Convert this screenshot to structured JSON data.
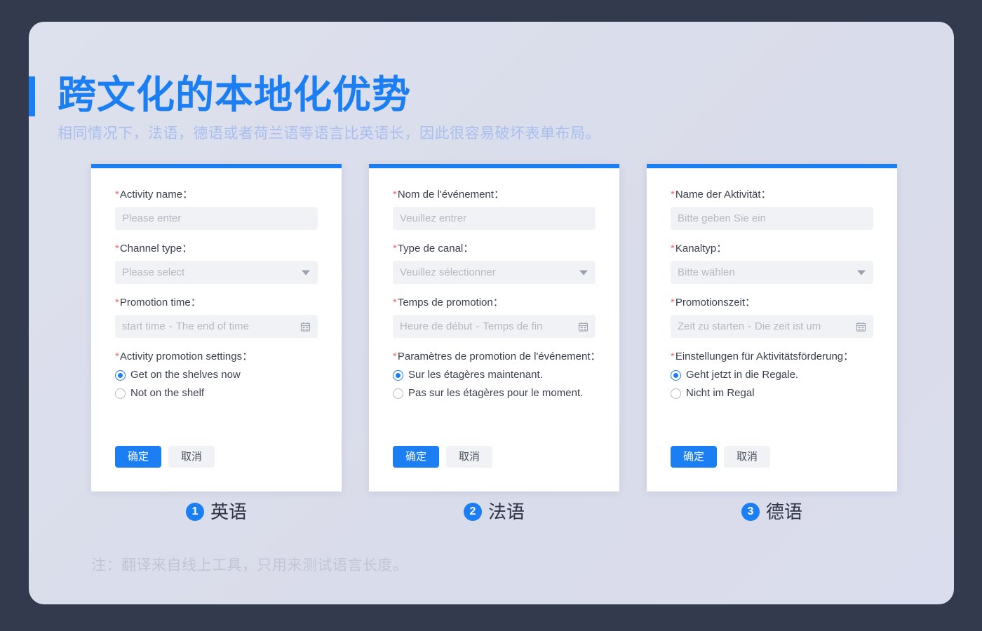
{
  "header": {
    "title": "跨文化的本地化优势",
    "subtitle": "相同情况下，法语，德语或者荷兰语等语言比英语长，因此很容易破坏表单布局。",
    "accent_color": "#1c7ef3",
    "subtitle_color": "#a9bef0"
  },
  "footer": {
    "note": "注：翻译来自线上工具，只用来测试语言长度。"
  },
  "common": {
    "required_star": "*",
    "date_dash": "-",
    "confirm_label": "确定",
    "cancel_label": "取消",
    "primary_color": "#1c7ef3",
    "input_bg": "#f0f2f5",
    "card_bg": "#ffffff",
    "panel_bg": "#dcdfec",
    "page_bg": "#333a4d"
  },
  "cards": [
    {
      "index": "1",
      "caption": "英语",
      "name_label": "Activity name：",
      "name_placeholder": "Please enter",
      "channel_label": "Channel type：",
      "channel_placeholder": "Please select",
      "time_label": "Promotion time：",
      "time_start_placeholder": "start time",
      "time_end_placeholder": "The end of time",
      "promo_label": "Activity promotion settings：",
      "radio_on": "Get on the shelves now",
      "radio_off": "Not on the shelf",
      "confirm_label": "确定",
      "cancel_label": "取消"
    },
    {
      "index": "2",
      "caption": "法语",
      "name_label": "Nom de l'événement：",
      "name_placeholder": "Veuillez entrer",
      "channel_label": "Type de canal：",
      "channel_placeholder": "Veuillez sélectionner",
      "time_label": "Temps de promotion：",
      "time_start_placeholder": "Heure de début",
      "time_end_placeholder": "Temps de fin",
      "promo_label": "Paramètres de promotion de l'événement：",
      "radio_on": "Sur les étagères maintenant.",
      "radio_off": "Pas sur les étagères pour le moment.",
      "confirm_label": "确定",
      "cancel_label": "取消"
    },
    {
      "index": "3",
      "caption": "德语",
      "name_label": "Name der Aktivität：",
      "name_placeholder": "Bitte geben Sie ein",
      "channel_label": "Kanaltyp：",
      "channel_placeholder": "Bitte wählen",
      "time_label": "Promotionszeit：",
      "time_start_placeholder": "Zeit zu starten",
      "time_end_placeholder": "Die zeit ist um",
      "promo_label": "Einstellungen für Aktivitätsförderung：",
      "radio_on": "Geht jetzt in die Regale.",
      "radio_off": "Nicht im Regal",
      "confirm_label": "确定",
      "cancel_label": "取消"
    }
  ]
}
